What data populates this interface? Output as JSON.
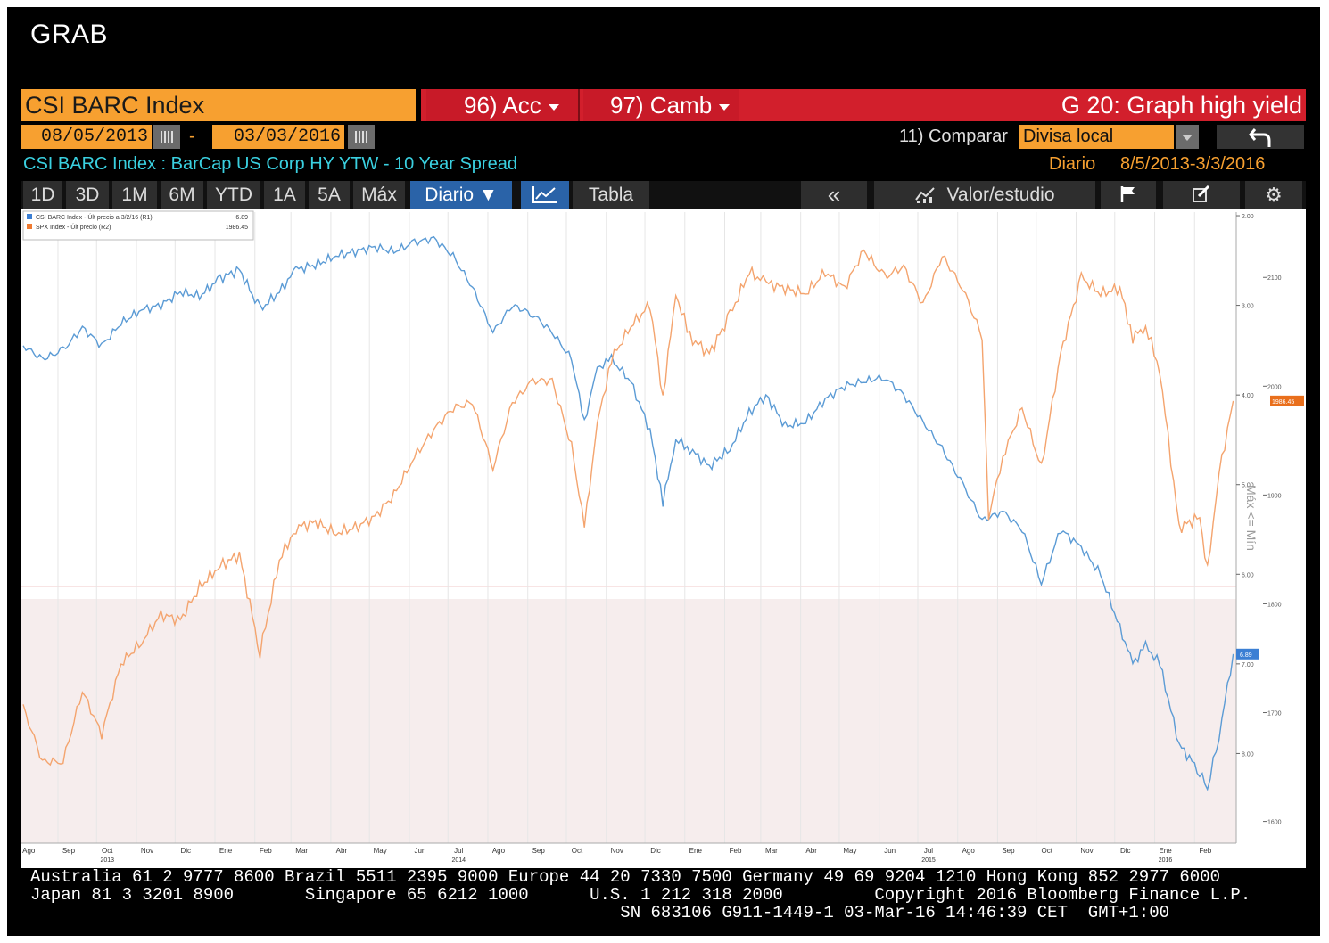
{
  "window": {
    "title": "GRAB"
  },
  "header": {
    "ticker": "CSI BARC Index",
    "acc_button": "96) Acc",
    "camb_button": "97) Camb",
    "graph_title": "G 20: Graph high yield"
  },
  "dates": {
    "start": "08/05/2013",
    "separator": "-",
    "end": "03/03/2016",
    "compare_label": "11) Comparar",
    "currency_value": "Divisa local",
    "back_icon": "undo-arrow-icon"
  },
  "info": {
    "description": "CSI BARC Index : BarCap US Corp HY YTW - 10 Year Spread",
    "frequency": "Diario",
    "range": "8/5/2013-3/3/2016"
  },
  "toolbar": {
    "periods": [
      "1D",
      "3D",
      "1M",
      "6M",
      "YTD",
      "1A",
      "5A",
      "Máx"
    ],
    "frequency_dropdown": "Diario ▼",
    "line_chart_icon": "line-chart-icon",
    "table_label": "Tabla",
    "collapse_icon": "double-chevron-left-icon",
    "study_icon": "study-chart-icon",
    "study_label": "Valor/estudio",
    "flag_icon": "flag-icon",
    "edit_icon": "edit-icon",
    "settings_icon": "gear-icon"
  },
  "chart_data": {
    "type": "line",
    "colors": {
      "barc": "#5b9bd5",
      "spx": "#f4a46e",
      "shade": "#f6eded"
    },
    "legend": [
      {
        "name": "CSI BARC Index - Últ precio a 3/2/16 (R1)",
        "value": "6.89",
        "color": "#3b7fd4"
      },
      {
        "name": "SPX Index - Últ precio (R2)",
        "value": "1986.45",
        "color": "#f07a30"
      }
    ],
    "left_axis": {
      "ticks": [
        "2.00",
        "3.00",
        "4.00",
        "5.00",
        "6.00",
        "7.00",
        "8.00"
      ],
      "inverted": true,
      "range": [
        1.96,
        9.0
      ],
      "last_value": "6.89"
    },
    "right_axis": {
      "ticks": [
        "2100",
        "2000",
        "1900",
        "1800",
        "1700",
        "1600"
      ],
      "range": [
        1580,
        2160
      ],
      "last_value": "1986.45"
    },
    "axis_note": "Máx <= Mín",
    "x_months": [
      "Ago",
      "Sep",
      "Oct",
      "Nov",
      "Dic",
      "Ene",
      "Feb",
      "Mar",
      "Abr",
      "May",
      "Jun",
      "Jul",
      "Ago",
      "Sep",
      "Oct",
      "Nov",
      "Dic",
      "Ene",
      "Feb",
      "Mar",
      "Abr",
      "May",
      "Jun",
      "Jul",
      "Ago",
      "Sep",
      "Oct",
      "Nov",
      "Dic",
      "Ene",
      "Feb"
    ],
    "x_years": [
      "2013",
      "2014",
      "2015",
      "2016"
    ],
    "series": [
      {
        "name": "CSI BARC Index",
        "axis": "left",
        "points": [
          [
            "2013-08-05",
            3.45
          ],
          [
            "2013-08-20",
            3.6
          ],
          [
            "2013-09-05",
            3.5
          ],
          [
            "2013-09-20",
            3.25
          ],
          [
            "2013-10-05",
            3.45
          ],
          [
            "2013-10-20",
            3.2
          ],
          [
            "2013-11-05",
            3.05
          ],
          [
            "2013-11-20",
            3.0
          ],
          [
            "2013-12-05",
            2.85
          ],
          [
            "2013-12-20",
            2.9
          ],
          [
            "2014-01-05",
            2.7
          ],
          [
            "2014-01-20",
            2.6
          ],
          [
            "2014-02-05",
            3.05
          ],
          [
            "2014-02-20",
            2.85
          ],
          [
            "2014-03-05",
            2.6
          ],
          [
            "2014-03-20",
            2.55
          ],
          [
            "2014-04-05",
            2.45
          ],
          [
            "2014-04-20",
            2.4
          ],
          [
            "2014-05-05",
            2.35
          ],
          [
            "2014-05-20",
            2.4
          ],
          [
            "2014-06-05",
            2.3
          ],
          [
            "2014-06-20",
            2.25
          ],
          [
            "2014-07-05",
            2.45
          ],
          [
            "2014-07-20",
            2.8
          ],
          [
            "2014-08-05",
            3.3
          ],
          [
            "2014-08-20",
            3.0
          ],
          [
            "2014-09-05",
            3.1
          ],
          [
            "2014-09-20",
            3.3
          ],
          [
            "2014-10-05",
            3.6
          ],
          [
            "2014-10-15",
            4.3
          ],
          [
            "2014-10-25",
            3.7
          ],
          [
            "2014-11-05",
            3.6
          ],
          [
            "2014-11-20",
            3.85
          ],
          [
            "2014-12-05",
            4.4
          ],
          [
            "2014-12-15",
            5.2
          ],
          [
            "2014-12-25",
            4.5
          ],
          [
            "2015-01-05",
            4.6
          ],
          [
            "2015-01-20",
            4.8
          ],
          [
            "2015-02-05",
            4.6
          ],
          [
            "2015-02-20",
            4.2
          ],
          [
            "2015-03-05",
            4.0
          ],
          [
            "2015-03-20",
            4.35
          ],
          [
            "2015-04-05",
            4.3
          ],
          [
            "2015-04-20",
            4.05
          ],
          [
            "2015-05-05",
            3.9
          ],
          [
            "2015-05-20",
            3.85
          ],
          [
            "2015-06-05",
            3.8
          ],
          [
            "2015-06-20",
            4.0
          ],
          [
            "2015-07-05",
            4.3
          ],
          [
            "2015-07-20",
            4.6
          ],
          [
            "2015-08-05",
            5.0
          ],
          [
            "2015-08-20",
            5.4
          ],
          [
            "2015-09-05",
            5.3
          ],
          [
            "2015-09-20",
            5.5
          ],
          [
            "2015-10-05",
            6.1
          ],
          [
            "2015-10-20",
            5.5
          ],
          [
            "2015-11-05",
            5.7
          ],
          [
            "2015-11-20",
            6.0
          ],
          [
            "2015-12-05",
            6.6
          ],
          [
            "2015-12-15",
            7.0
          ],
          [
            "2015-12-25",
            6.8
          ],
          [
            "2016-01-05",
            7.0
          ],
          [
            "2016-01-20",
            7.9
          ],
          [
            "2016-02-05",
            8.2
          ],
          [
            "2016-02-11",
            8.4
          ],
          [
            "2016-02-20",
            7.8
          ],
          [
            "2016-03-02",
            6.89
          ]
        ]
      },
      {
        "name": "SPX Index",
        "axis": "right",
        "points": [
          [
            "2013-08-05",
            1705
          ],
          [
            "2013-08-20",
            1655
          ],
          [
            "2013-09-05",
            1655
          ],
          [
            "2013-09-20",
            1720
          ],
          [
            "2013-10-05",
            1680
          ],
          [
            "2013-10-20",
            1745
          ],
          [
            "2013-11-05",
            1765
          ],
          [
            "2013-11-20",
            1790
          ],
          [
            "2013-12-05",
            1785
          ],
          [
            "2013-12-20",
            1815
          ],
          [
            "2014-01-05",
            1835
          ],
          [
            "2014-01-20",
            1845
          ],
          [
            "2014-02-05",
            1755
          ],
          [
            "2014-02-20",
            1840
          ],
          [
            "2014-03-05",
            1870
          ],
          [
            "2014-03-20",
            1875
          ],
          [
            "2014-04-05",
            1865
          ],
          [
            "2014-04-20",
            1870
          ],
          [
            "2014-05-05",
            1880
          ],
          [
            "2014-05-20",
            1900
          ],
          [
            "2014-06-05",
            1935
          ],
          [
            "2014-06-20",
            1960
          ],
          [
            "2014-07-05",
            1980
          ],
          [
            "2014-07-20",
            1985
          ],
          [
            "2014-08-05",
            1925
          ],
          [
            "2014-08-20",
            1985
          ],
          [
            "2014-09-05",
            2005
          ],
          [
            "2014-09-20",
            2005
          ],
          [
            "2014-10-05",
            1945
          ],
          [
            "2014-10-15",
            1870
          ],
          [
            "2014-10-25",
            1965
          ],
          [
            "2014-11-05",
            2025
          ],
          [
            "2014-11-20",
            2055
          ],
          [
            "2014-12-05",
            2075
          ],
          [
            "2014-12-15",
            1990
          ],
          [
            "2014-12-25",
            2085
          ],
          [
            "2015-01-05",
            2045
          ],
          [
            "2015-01-20",
            2030
          ],
          [
            "2015-02-05",
            2065
          ],
          [
            "2015-02-20",
            2105
          ],
          [
            "2015-03-05",
            2095
          ],
          [
            "2015-03-20",
            2090
          ],
          [
            "2015-04-05",
            2085
          ],
          [
            "2015-04-20",
            2105
          ],
          [
            "2015-05-05",
            2090
          ],
          [
            "2015-05-20",
            2125
          ],
          [
            "2015-06-05",
            2100
          ],
          [
            "2015-06-20",
            2110
          ],
          [
            "2015-07-05",
            2075
          ],
          [
            "2015-07-20",
            2120
          ],
          [
            "2015-08-05",
            2090
          ],
          [
            "2015-08-20",
            2045
          ],
          [
            "2015-08-25",
            1880
          ],
          [
            "2015-09-05",
            1935
          ],
          [
            "2015-09-20",
            1980
          ],
          [
            "2015-10-05",
            1925
          ],
          [
            "2015-10-20",
            2030
          ],
          [
            "2015-11-05",
            2100
          ],
          [
            "2015-11-20",
            2085
          ],
          [
            "2015-12-05",
            2090
          ],
          [
            "2015-12-15",
            2045
          ],
          [
            "2015-12-25",
            2055
          ],
          [
            "2016-01-05",
            2015
          ],
          [
            "2016-01-20",
            1870
          ],
          [
            "2016-02-05",
            1880
          ],
          [
            "2016-02-11",
            1830
          ],
          [
            "2016-02-20",
            1920
          ],
          [
            "2016-03-02",
            1986.45
          ]
        ]
      }
    ]
  },
  "footer": {
    "line1": "Australia 61 2 9777 8600 Brazil 5511 2395 9000 Europe 44 20 7330 7500 Germany 49 69 9204 1210 Hong Kong 852 2977 6000",
    "line2": "Japan 81 3 3201 8900       Singapore 65 6212 1000      U.S. 1 212 318 2000         Copyright 2016 Bloomberg Finance L.P.",
    "line3": "                                                          SN 683106 G911-1449-1 03-Mar-16 14:46:39 CET  GMT+1:00"
  }
}
